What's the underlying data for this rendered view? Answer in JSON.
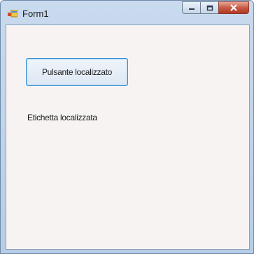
{
  "window": {
    "title": "Form1",
    "icon": "form-icon",
    "caption_buttons": [
      "minimize-icon",
      "maximize-icon",
      "close-icon"
    ]
  },
  "form": {
    "button_label": "Pulsante localizzato",
    "label_text": "Etichetta localizzata"
  },
  "colors": {
    "title_bar": "#c3d6ec",
    "client_background": "#f7f3f3",
    "button_border": "#3b8fd0",
    "close_button": "#c75a45"
  }
}
